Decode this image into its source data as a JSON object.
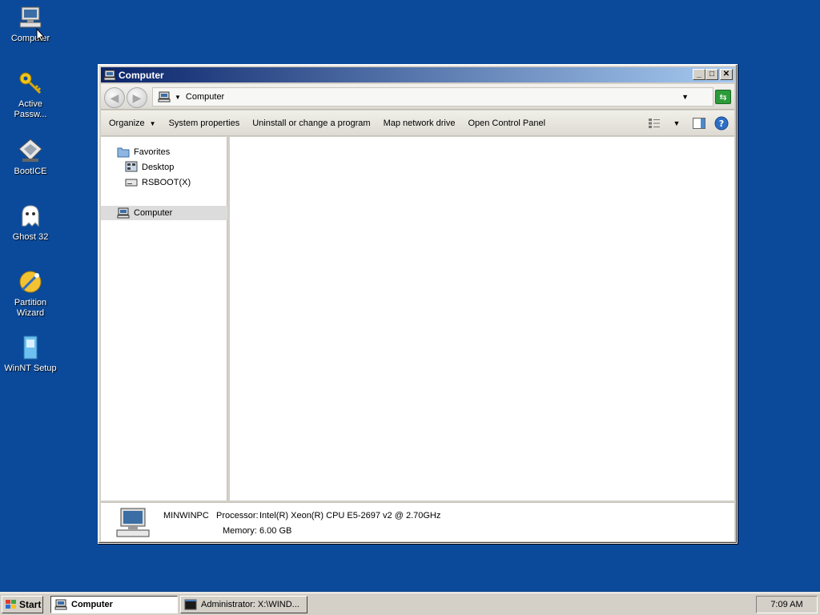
{
  "desktop": {
    "icons": [
      {
        "name": "computer-desktop-icon",
        "label": "Computer"
      },
      {
        "name": "active-password-desktop-icon",
        "label": "Active\nPassw..."
      },
      {
        "name": "bootice-desktop-icon",
        "label": "BootICE"
      },
      {
        "name": "ghost32-desktop-icon",
        "label": "Ghost 32"
      },
      {
        "name": "partition-wizard-desktop-icon",
        "label": "Partition\nWizard"
      },
      {
        "name": "winnt-setup-desktop-icon",
        "label": "WinNT Setup"
      }
    ]
  },
  "window": {
    "title": "Computer",
    "address": "Computer",
    "commands": {
      "organize": "Organize",
      "system_properties": "System properties",
      "uninstall": "Uninstall or change a program",
      "map_drive": "Map network drive",
      "control_panel": "Open Control Panel"
    },
    "nav": {
      "favorites": "Favorites",
      "desktop": "Desktop",
      "rsboot": "RSBOOT(X)",
      "computer": "Computer"
    },
    "details": {
      "name": "MINWINPC",
      "processor_label": "Processor:",
      "processor_value": "Intel(R) Xeon(R) CPU E5-2697 v2 @ 2.70GHz",
      "memory_label": "Memory:",
      "memory_value": "6.00 GB"
    }
  },
  "taskbar": {
    "start": "Start",
    "tasks": {
      "computer": "Computer",
      "admin": "Administrator: X:\\WIND..."
    },
    "clock": "7:09 AM"
  },
  "colors": {
    "desktop": "#0b4a9a",
    "title_start": "#0a246a",
    "title_end": "#a6caf0"
  }
}
